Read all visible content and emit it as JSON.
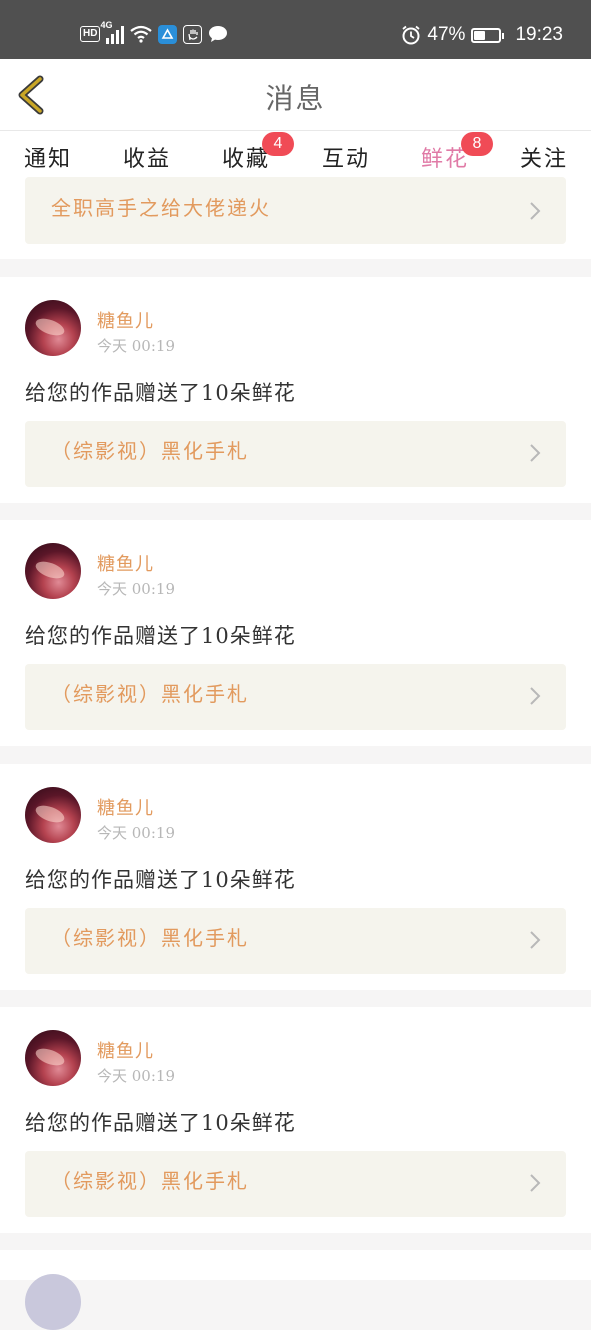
{
  "status_bar": {
    "network_tag": "HD",
    "network_type": "4G",
    "battery_percent": "47%",
    "battery_level": 0.47,
    "time": "19:23",
    "icons": [
      "hd-icon",
      "signal-icon",
      "wifi-icon",
      "app-notification-icon",
      "hand-icon",
      "chat-icon",
      "alarm-icon",
      "battery-icon"
    ]
  },
  "header": {
    "title": "消息",
    "back_icon": "chevron-left-icon"
  },
  "tabs": [
    {
      "label": "通知"
    },
    {
      "label": "收益"
    },
    {
      "label": "收藏",
      "badge": "4"
    },
    {
      "label": "互动"
    },
    {
      "label": "鲜花",
      "badge": "8",
      "active": true
    },
    {
      "label": "关注"
    }
  ],
  "first_card": {
    "book_title": "全职高手之给大佬递火"
  },
  "messages": [
    {
      "username": "糖鱼儿",
      "time": "今天 00:19",
      "text": "给您的作品赠送了10朵鲜花",
      "book_title": "（综影视）黑化手札"
    },
    {
      "username": "糖鱼儿",
      "time": "今天 00:19",
      "text": "给您的作品赠送了10朵鲜花",
      "book_title": "（综影视）黑化手札"
    },
    {
      "username": "糖鱼儿",
      "time": "今天 00:19",
      "text": "给您的作品赠送了10朵鲜花",
      "book_title": "（综影视）黑化手札"
    },
    {
      "username": "糖鱼儿",
      "time": "今天 00:19",
      "text": "给您的作品赠送了10朵鲜花",
      "book_title": "（综影视）黑化手札"
    }
  ],
  "colors": {
    "accent": "#e07aa6",
    "book_title": "#e29a5e",
    "badge": "#f04b56",
    "back_icon": "#c9a626"
  }
}
